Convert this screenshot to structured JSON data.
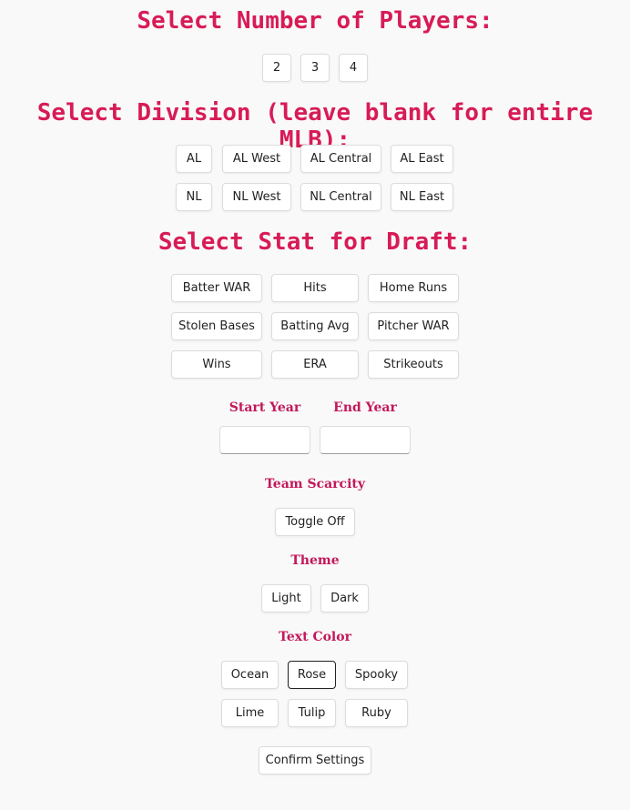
{
  "players": {
    "heading": "Select Number of Players:",
    "options": [
      "2",
      "3",
      "4"
    ]
  },
  "division": {
    "heading": "Select Division (leave blank for entire MLB):",
    "al": [
      "AL",
      "AL West",
      "AL Central",
      "AL East"
    ],
    "nl": [
      "NL",
      "NL West",
      "NL Central",
      "NL East"
    ]
  },
  "stat": {
    "heading": "Select Stat for Draft:",
    "row1": [
      "Batter WAR",
      "Hits",
      "Home Runs"
    ],
    "row2": [
      "Stolen Bases",
      "Batting Avg",
      "Pitcher WAR"
    ],
    "row3": [
      "Wins",
      "ERA",
      "Strikeouts"
    ]
  },
  "years": {
    "start_label": "Start Year",
    "end_label": "End Year",
    "start_value": "",
    "end_value": ""
  },
  "scarcity": {
    "label": "Team Scarcity",
    "toggle_label": "Toggle Off"
  },
  "theme": {
    "label": "Theme",
    "options": [
      "Light",
      "Dark"
    ]
  },
  "text_color": {
    "label": "Text Color",
    "row1": [
      "Ocean",
      "Rose",
      "Spooky"
    ],
    "row2": [
      "Lime",
      "Tulip",
      "Ruby"
    ],
    "selected": "Rose"
  },
  "confirm_label": "Confirm Settings",
  "colors": {
    "accent": "#d81b56",
    "label": "#c2185b",
    "background": "#f9f9f9"
  }
}
